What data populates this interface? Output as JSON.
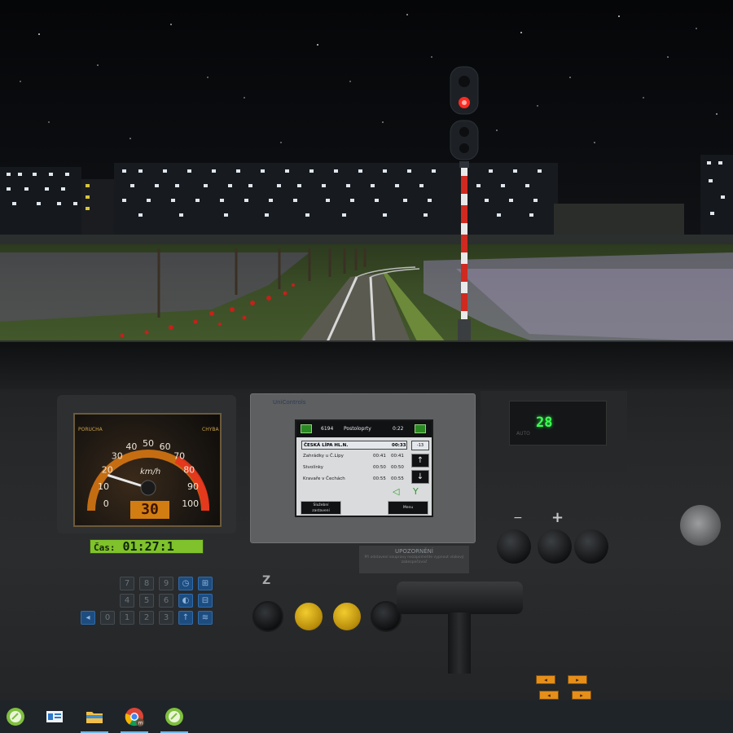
{
  "speedometer": {
    "unit": "km/h",
    "ticks": [
      "0",
      "10",
      "20",
      "30",
      "40",
      "50",
      "60",
      "70",
      "80",
      "90",
      "100"
    ],
    "current_speed_readout": "30",
    "left_label": "PORUCHA",
    "right_label": "CHYBA",
    "needle_value_kmh": 17
  },
  "clock": {
    "label": "Čas:",
    "time": "01:27:1"
  },
  "keypad": {
    "keys": [
      "7",
      "8",
      "9",
      "4",
      "5",
      "6",
      "0",
      "1",
      "2",
      "3"
    ]
  },
  "display_unit": {
    "brand": "UniControls",
    "header_code": "6194",
    "header_title": "Postoloprty",
    "header_time": "0:22",
    "rows": [
      {
        "station": "ČESKÁ LÍPA HL.N.",
        "arr": "",
        "dep": "00:33",
        "delay": "-13"
      },
      {
        "station": "Zahrádky u Č.Lípy",
        "arr": "00:41",
        "dep": "00:41",
        "delay": ""
      },
      {
        "station": "Stvolínky",
        "arr": "00:50",
        "dep": "00:50",
        "delay": ""
      },
      {
        "station": "Kravaře v Čechách",
        "arr": "00:55",
        "dep": "00:55",
        "delay": ""
      }
    ],
    "button_left_line1": "Služební",
    "button_left_line2": "zastavení",
    "button_right": "Menu",
    "arrow_up": "↑",
    "arrow_down": "↓"
  },
  "notice": {
    "title": "UPOZORNĚNÍ",
    "text": "Při odstavení soupravy nezapomeňte vypnout vlakový zabezpečovač"
  },
  "temperature_display": {
    "value": "28",
    "label": "AUTO"
  },
  "switch_label": "Z",
  "taskbar": {
    "items": [
      {
        "name": "app-1",
        "active": false
      },
      {
        "name": "task-view",
        "active": false
      },
      {
        "name": "file-explorer",
        "active": true
      },
      {
        "name": "chrome",
        "active": true
      },
      {
        "name": "app-2",
        "active": true
      }
    ]
  },
  "colors": {
    "signal_red": "#ff2a22",
    "display_green": "#3bff52",
    "clock_green": "#7fc22b",
    "speedo_orange": "#e07a12",
    "taskbar_bg": "#1f2428"
  }
}
